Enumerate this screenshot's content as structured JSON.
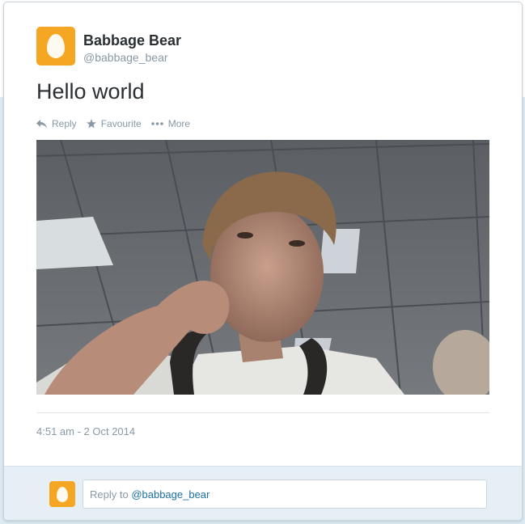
{
  "tweet": {
    "author_name": "Babbage Bear",
    "author_handle": "@babbage_bear",
    "text": "Hello world",
    "timestamp": "4:51 am - 2 Oct 2014"
  },
  "actions": [
    {
      "label": "Reply",
      "icon": "reply-icon"
    },
    {
      "label": "Favourite",
      "icon": "star-icon"
    },
    {
      "label": "More",
      "icon": "more-icon"
    }
  ],
  "reply": {
    "prefix": "Reply to ",
    "mention": "@babbage_bear"
  },
  "colors": {
    "avatar_bg": "#f5a623",
    "text": "#292f33",
    "muted": "#8899a6",
    "link": "#1b6fa3",
    "reply_bg": "#e6eff5"
  }
}
